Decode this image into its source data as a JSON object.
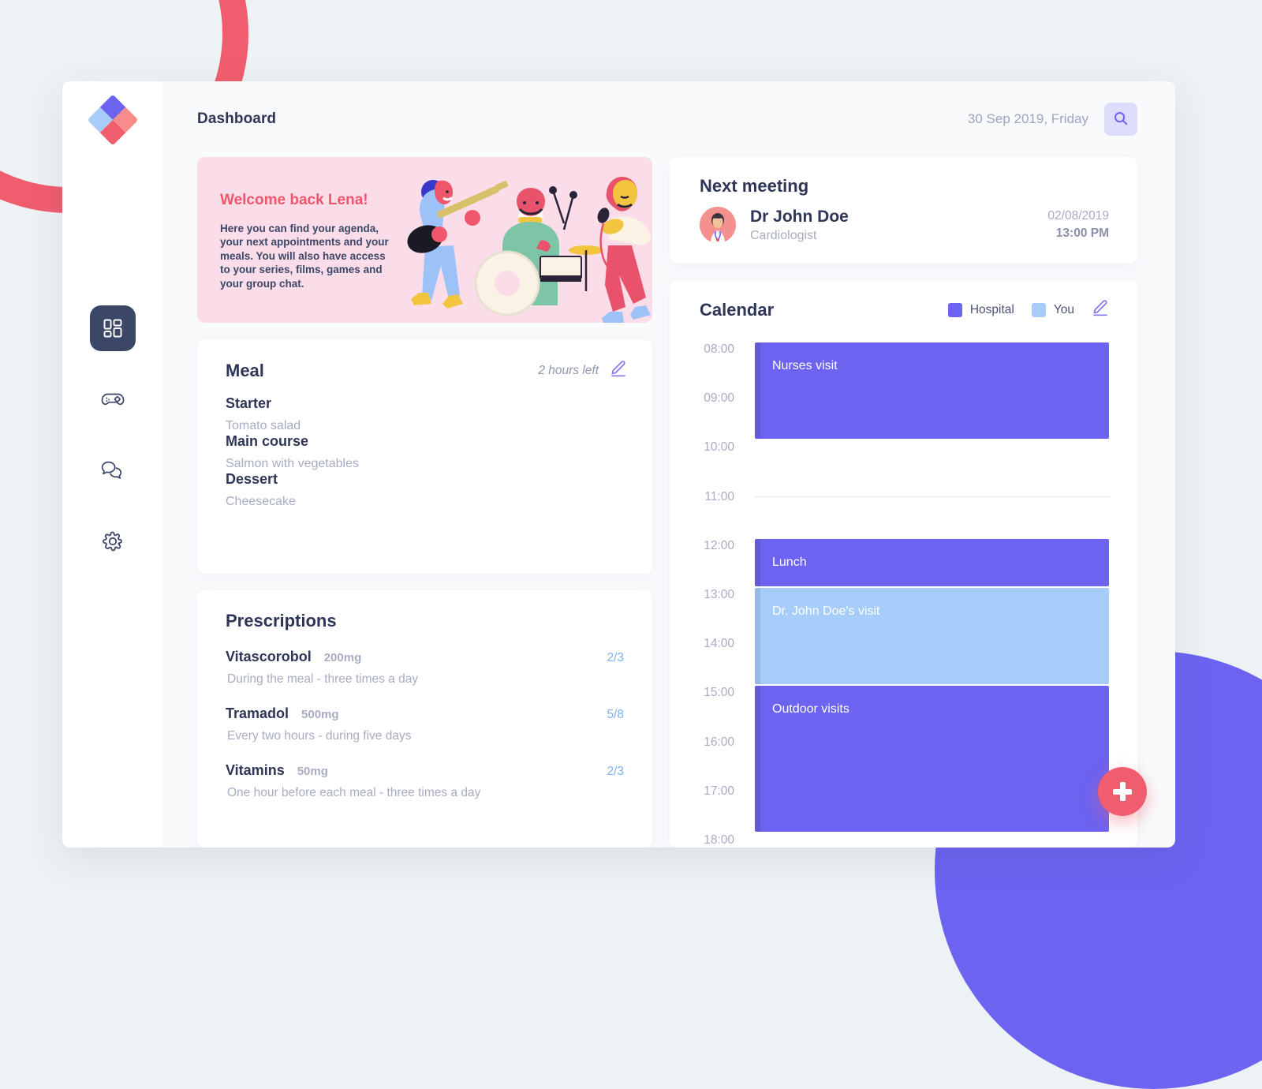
{
  "app": {
    "title": "Dashboard",
    "date": "30 Sep 2019, Friday",
    "search_icon": "search-icon"
  },
  "sidebar": {
    "logo": "app-logo-diamond",
    "items": [
      {
        "icon": "dashboard-grid-icon",
        "label": "Dashboard",
        "active": true
      },
      {
        "icon": "gamepad-icon",
        "label": "Games",
        "active": false
      },
      {
        "icon": "chat-bubbles-icon",
        "label": "Chat",
        "active": false
      },
      {
        "icon": "gear-icon",
        "label": "Settings",
        "active": false
      }
    ]
  },
  "welcome": {
    "title": "Welcome back Lena!",
    "body": "Here you can find your agenda, your next appointments and your meals. You will also have access to your series, films, games and your group chat.",
    "illustration": "band-playing-music-illustration",
    "bg_color": "#FBDCE9",
    "title_color": "#F0566B"
  },
  "meal": {
    "title": "Meal",
    "time_left": "2 hours left",
    "edit_icon": "pencil-edit-icon",
    "courses": [
      {
        "course": "Starter",
        "item": "Tomato salad"
      },
      {
        "course": "Main course",
        "item": "Salmon with vegetables"
      },
      {
        "course": "Dessert",
        "item": "Cheesecake"
      }
    ]
  },
  "prescriptions": {
    "title": "Prescriptions",
    "items": [
      {
        "name": "Vitascorobol",
        "dose": "200mg",
        "count": "2/3",
        "note": "During the meal - three times a day"
      },
      {
        "name": "Tramadol",
        "dose": "500mg",
        "count": "5/8",
        "note": "Every two hours - during five days"
      },
      {
        "name": "Vitamins",
        "dose": "50mg",
        "count": "2/3",
        "note": "One hour before each meal - three times a day"
      }
    ]
  },
  "next_meeting": {
    "title": "Next meeting",
    "avatar": "doctor-avatar",
    "name": "Dr John Doe",
    "role": "Cardiologist",
    "date": "02/08/2019",
    "time": "13:00 PM"
  },
  "calendar": {
    "title": "Calendar",
    "edit_icon": "pencil-edit-icon",
    "legend": [
      {
        "label": "Hospital",
        "color": "#6C63F0"
      },
      {
        "label": "You",
        "color": "#A6CCFA"
      }
    ],
    "hours": [
      "08:00",
      "09:00",
      "10:00",
      "11:00",
      "12:00",
      "13:00",
      "14:00",
      "15:00",
      "16:00",
      "17:00",
      "18:00"
    ],
    "divider_hours": [
      "11:00"
    ],
    "events": [
      {
        "label": "Nurses visit",
        "start": "08:00",
        "end": "10:00",
        "type": "Hospital"
      },
      {
        "label": "Lunch",
        "start": "12:00",
        "end": "13:00",
        "type": "Hospital"
      },
      {
        "label": "Dr. John Doe's visit",
        "start": "13:00",
        "end": "15:00",
        "type": "You"
      },
      {
        "label": "Outdoor visits",
        "start": "15:00",
        "end": "18:00",
        "type": "Hospital"
      }
    ]
  },
  "fab": {
    "label": "Add",
    "icon": "plus-icon",
    "color": "#F05D6E"
  }
}
